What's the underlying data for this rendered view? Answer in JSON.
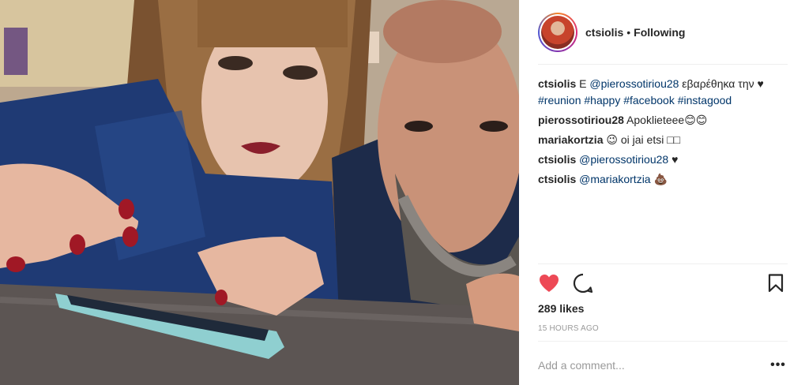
{
  "post": {
    "header": {
      "username": "ctsiolis",
      "separator": "•",
      "follow_status": "Following"
    },
    "comments": [
      {
        "user": "ctsiolis",
        "parts": [
          {
            "text": "Ε ",
            "link": false
          },
          {
            "text": "@pierossotiriou28",
            "link": true
          },
          {
            "text": " εβαρέθηκα την ",
            "link": false
          },
          {
            "text": "♥ ",
            "link": false
          },
          {
            "text": "#reunion",
            "link": true
          },
          {
            "text": " ",
            "link": false
          },
          {
            "text": "#happy",
            "link": true
          },
          {
            "text": " ",
            "link": false
          },
          {
            "text": "#facebook",
            "link": true
          },
          {
            "text": " ",
            "link": false
          },
          {
            "text": "#instagood",
            "link": true
          }
        ]
      },
      {
        "user": "pierossotiriou28",
        "parts": [
          {
            "text": "Apoklieteee😊😊",
            "link": false
          }
        ]
      },
      {
        "user": "mariakortzia",
        "parts": [
          {
            "text": "😉 oi jai etsi □□",
            "link": false
          }
        ]
      },
      {
        "user": "ctsiolis",
        "parts": [
          {
            "text": "@pierossotiriou28",
            "link": true
          },
          {
            "text": " ♥",
            "link": false
          }
        ]
      },
      {
        "user": "ctsiolis",
        "parts": [
          {
            "text": "@mariakortzia",
            "link": true
          },
          {
            "text": " 💩",
            "link": false
          }
        ]
      }
    ],
    "actions": {
      "like_icon": "heart-filled-icon",
      "comment_icon": "comment-bubble-icon",
      "save_icon": "bookmark-icon",
      "like_color": "#ed4956"
    },
    "likes": "289 likes",
    "timestamp": "15 HOURS AGO",
    "add_comment_placeholder": "Add a comment...",
    "more_label": "•••"
  }
}
